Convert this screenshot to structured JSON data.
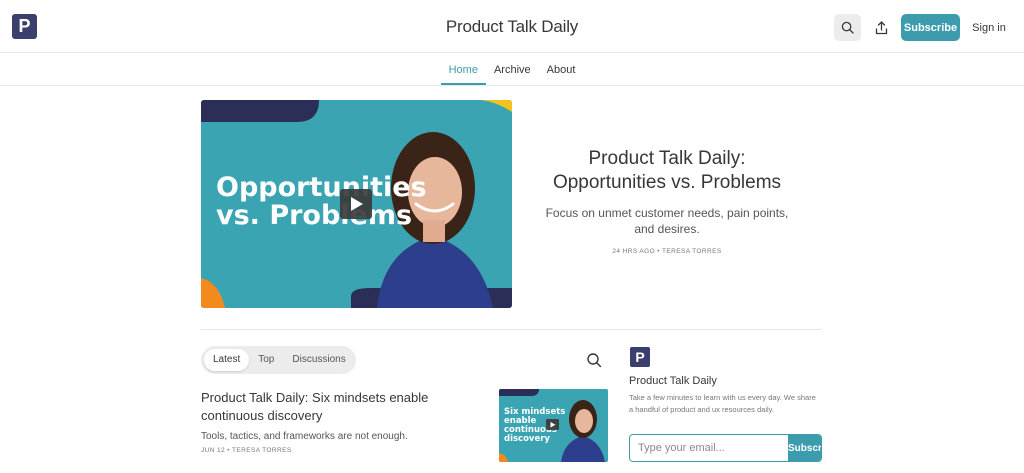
{
  "header": {
    "logo_letter": "P",
    "site_title": "Product Talk Daily",
    "subscribe_label": "Subscribe",
    "signin_label": "Sign in"
  },
  "nav": {
    "items": [
      {
        "label": "Home",
        "active": true
      },
      {
        "label": "Archive",
        "active": false
      },
      {
        "label": "About",
        "active": false
      }
    ]
  },
  "hero": {
    "image_text_line1": "Opportunities",
    "image_text_line2": "vs. Problems",
    "title": "Product Talk Daily: Opportunities vs. Problems",
    "subtitle": "Focus on unmet customer needs, pain points, and desires.",
    "meta": "24 HRS AGO • TERESA TORRES"
  },
  "feed": {
    "tabs": [
      {
        "label": "Latest",
        "active": true
      },
      {
        "label": "Top",
        "active": false
      },
      {
        "label": "Discussions",
        "active": false
      }
    ],
    "post": {
      "title": "Product Talk Daily: Six mindsets enable continuous discovery",
      "subtitle": "Tools, tactics, and frameworks are not enough.",
      "meta": "JUN 12 • TERESA TORRES",
      "thumb_text_line1": "Six mindsets",
      "thumb_text_line2": "enable",
      "thumb_text_line3": "continuous",
      "thumb_text_line4": "discovery"
    }
  },
  "sidebar": {
    "logo_letter": "P",
    "title": "Product Talk Daily",
    "description": "Take a few minutes to learn with us every day. We share a handful of product and ux resources daily.",
    "email_placeholder": "Type your email...",
    "subscribe_label": "Subscribe"
  },
  "colors": {
    "accent": "#3c9cae",
    "brand_navy": "#3b3f6e",
    "image_teal": "#3aa4b2",
    "image_orange": "#f28a1e"
  },
  "icons": [
    "search-icon",
    "share-icon",
    "play-icon",
    "feed-search-icon"
  ]
}
